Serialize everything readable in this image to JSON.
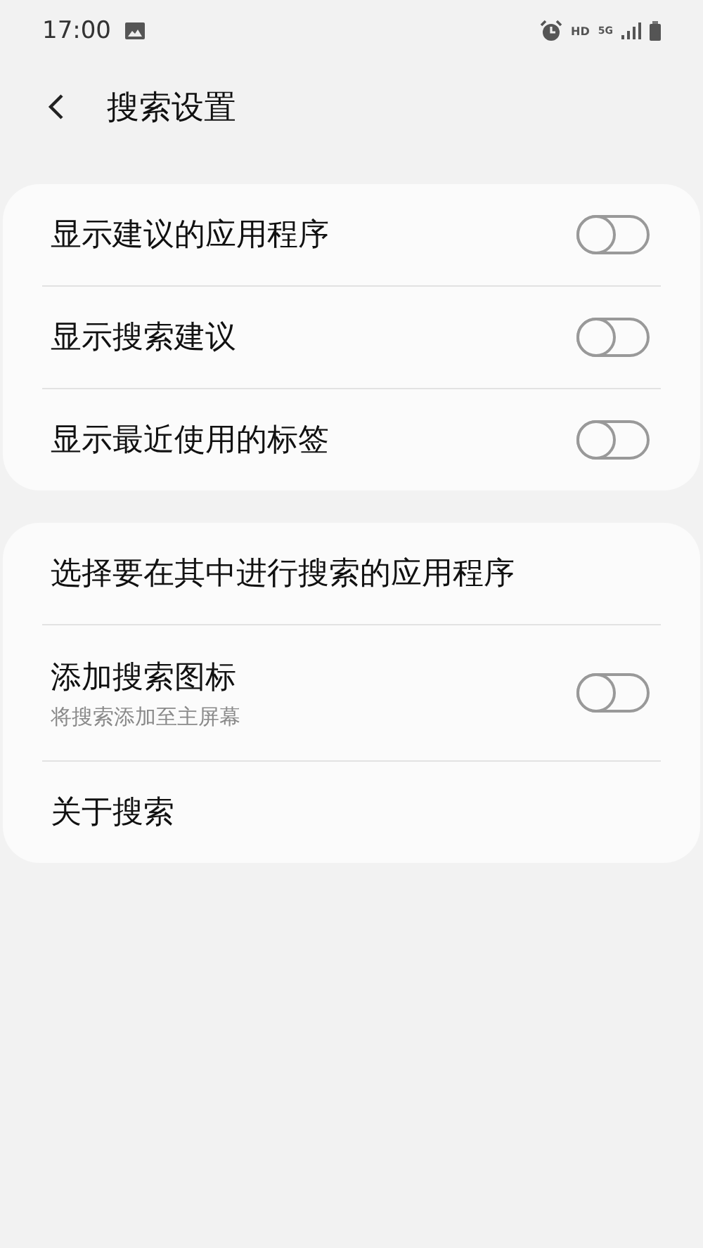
{
  "status_bar": {
    "time": "17:00",
    "hd": "HD",
    "network": "5G"
  },
  "header": {
    "title": "搜索设置"
  },
  "groups": [
    {
      "items": [
        {
          "kind": "toggle",
          "label": "显示建议的应用程序",
          "on": false
        },
        {
          "kind": "toggle",
          "label": "显示搜索建议",
          "on": false
        },
        {
          "kind": "toggle",
          "label": "显示最近使用的标签",
          "on": false
        }
      ]
    },
    {
      "items": [
        {
          "kind": "link",
          "label": "选择要在其中进行搜索的应用程序"
        },
        {
          "kind": "toggle",
          "label": "添加搜索图标",
          "sublabel": "将搜索添加至主屏幕",
          "on": false
        },
        {
          "kind": "link",
          "label": "关于搜索"
        }
      ]
    }
  ]
}
